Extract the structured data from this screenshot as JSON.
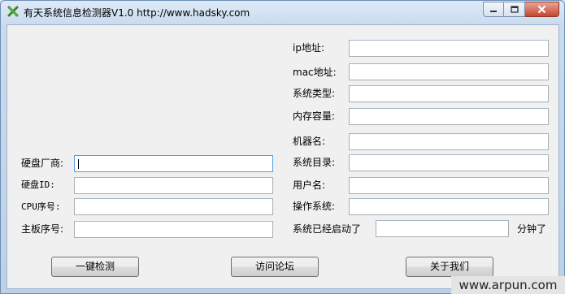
{
  "window": {
    "title": "有天系统信息检测器V1.0  http://www.hadsky.com",
    "controls": {
      "minimize_icon": "minimize-icon",
      "maximize_icon": "maximize-icon",
      "close_icon": "close-icon"
    }
  },
  "left_fields": [
    {
      "label": "硬盘厂商:",
      "value": ""
    },
    {
      "label": "硬盘ID:",
      "value": ""
    },
    {
      "label": "CPU序号:",
      "value": ""
    },
    {
      "label": "主板序号:",
      "value": ""
    }
  ],
  "right_fields": [
    {
      "label": "ip地址:",
      "value": ""
    },
    {
      "label": "mac地址:",
      "value": ""
    },
    {
      "label": "系统类型:",
      "value": ""
    },
    {
      "label": "内存容量:",
      "value": ""
    },
    {
      "label": "机器名:",
      "value": ""
    },
    {
      "label": "系统目录:",
      "value": ""
    },
    {
      "label": "用户名:",
      "value": ""
    },
    {
      "label": "操作系统:",
      "value": ""
    }
  ],
  "uptime": {
    "label": "系统已经启动了",
    "value": "",
    "unit": "分钟了"
  },
  "buttons": {
    "detect": "一键检测",
    "forum": "访问论坛",
    "about": "关于我们"
  },
  "watermark": "www.arpun.com"
}
